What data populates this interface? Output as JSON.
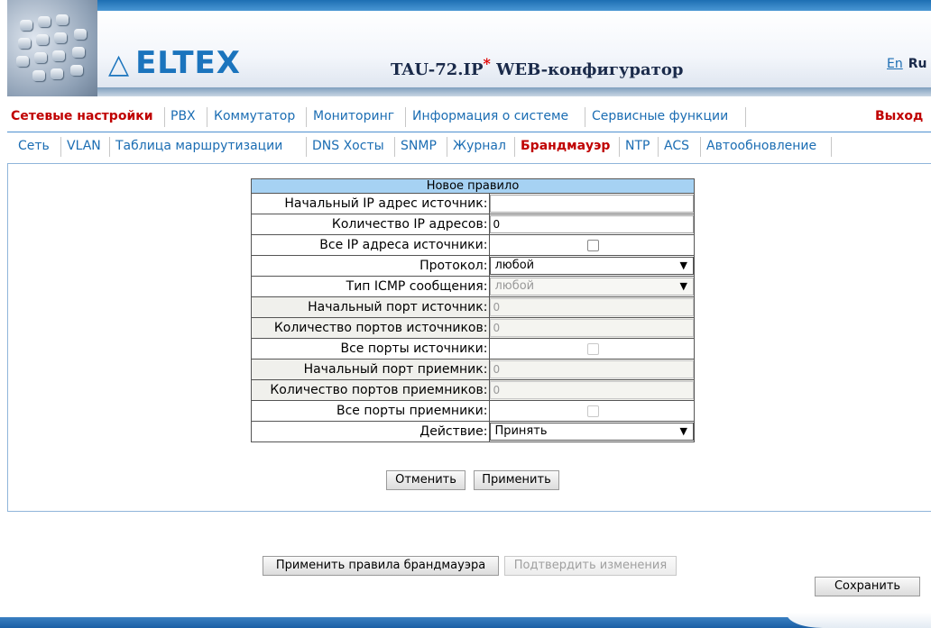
{
  "header": {
    "brand": "ELTEX",
    "title_main": "TAU-72.IP",
    "title_star": "*",
    "title_suffix": " WEB-конфигуратор",
    "lang_en": "En",
    "lang_ru": "Ru"
  },
  "menu1": {
    "items": [
      "Сетевые настройки",
      "PBX",
      "Коммутатор",
      "Мониторинг",
      "Информация о системе",
      "Сервисные функции"
    ],
    "active": "Сетевые настройки",
    "exit": "Выход"
  },
  "menu2": {
    "items": [
      "Сеть",
      "VLAN",
      "Таблица маршрутизации",
      "DNS Хосты",
      "SNMP",
      "Журнал",
      "Брандмауэр",
      "NTP",
      "ACS",
      "Автообновление"
    ],
    "active": "Брандмауэр"
  },
  "form": {
    "header": "Новое правило",
    "src_ip_label": "Начальный IP адрес источник:",
    "src_ip_value": "",
    "ip_count_label": "Количество IP адресов:",
    "ip_count_value": "0",
    "all_src_ip_label": "Все IP адреса источники:",
    "all_src_ip_checked": false,
    "protocol_label": "Протокол:",
    "protocol_value": "любой",
    "icmp_label": "Тип ICMP сообщения:",
    "icmp_value": "любой",
    "src_port_label": "Начальный порт источник:",
    "src_port_value": "0",
    "src_port_count_label": "Количество портов источников:",
    "src_port_count_value": "0",
    "all_src_ports_label": "Все порты источники:",
    "all_src_ports_checked": false,
    "dst_port_label": "Начальный порт приемник:",
    "dst_port_value": "0",
    "dst_port_count_label": "Количество портов приемников:",
    "dst_port_count_value": "0",
    "all_dst_ports_label": "Все порты приемники:",
    "all_dst_ports_checked": false,
    "action_label": "Действие:",
    "action_value": "Принять"
  },
  "buttons": {
    "cancel": "Отменить",
    "apply": "Применить",
    "apply_rules": "Применить правила брандмауэра",
    "confirm": "Подтвердить изменения",
    "save": "Сохранить"
  },
  "colors": {
    "accent": "#1b6db3",
    "active": "#c00000",
    "form_header": "#a6d2f3"
  }
}
